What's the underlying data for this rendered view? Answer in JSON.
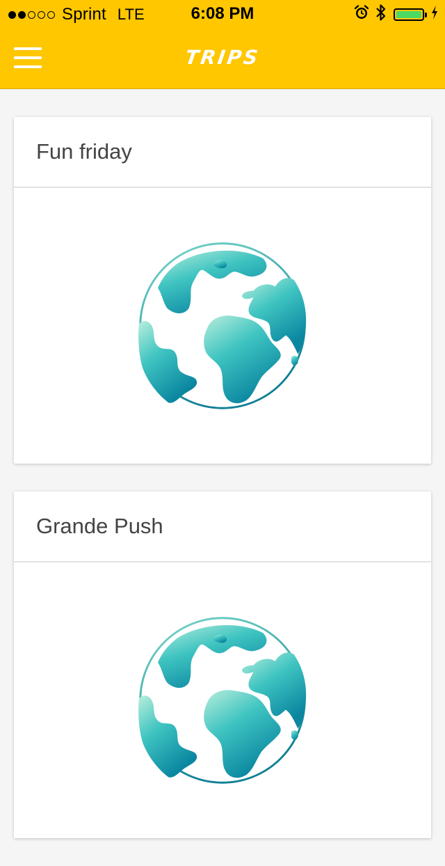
{
  "status_bar": {
    "carrier": "Sprint",
    "network": "LTE",
    "time": "6:08 PM",
    "signal_filled": 2,
    "signal_total": 5,
    "battery_level": 1.0,
    "icons": [
      "alarm-icon",
      "bluetooth-icon",
      "battery-icon",
      "charging-icon"
    ]
  },
  "nav": {
    "title": "Trips",
    "menu_icon": "hamburger-menu-icon"
  },
  "colors": {
    "accent": "#ffc700",
    "battery": "#4cd964",
    "globe_light": "#a8e6d6",
    "globe_dark": "#0d8fa3"
  },
  "trips": [
    {
      "name": "Fun friday",
      "icon": "globe-icon"
    },
    {
      "name": "Grande Push",
      "icon": "globe-icon"
    }
  ]
}
